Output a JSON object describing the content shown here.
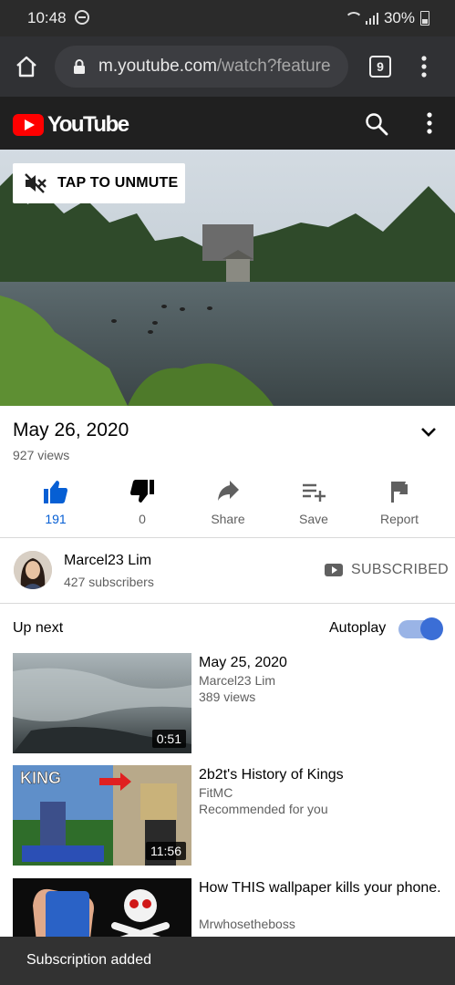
{
  "status_bar": {
    "time": "10:48",
    "battery": "30%"
  },
  "browser": {
    "url_host": "m.youtube.com",
    "url_path": "/watch?feature",
    "tab_count": "9"
  },
  "header": {
    "brand": "YouTube"
  },
  "video": {
    "unmute_label": "TAP TO UNMUTE"
  },
  "meta": {
    "title": "May 26, 2020",
    "views": "927 views"
  },
  "actions": {
    "like_count": "191",
    "dislike_count": "0",
    "share": "Share",
    "save": "Save",
    "report": "Report"
  },
  "channel": {
    "name": "Marcel23 Lim",
    "subscribers": "427 subscribers",
    "subscribed_label": "SUBSCRIBED"
  },
  "upnext": {
    "label": "Up next",
    "autoplay_label": "Autoplay",
    "autoplay_on": true
  },
  "videos": [
    {
      "title": "May 25, 2020",
      "channel": "Marcel23 Lim",
      "info": "389 views",
      "duration": "0:51"
    },
    {
      "title": "2b2t's History of Kings",
      "channel": "FitMC",
      "info": "Recommended for you",
      "duration": "11:56",
      "thumb_text": "KING"
    },
    {
      "title": "How THIS wallpaper kills your phone.",
      "channel": "Mrwhosetheboss",
      "info": ""
    }
  ],
  "snackbar": {
    "message": "Subscription added"
  },
  "colors": {
    "brand_red": "#ff0000",
    "link_blue": "#065fd4",
    "toggle_blue": "#3b6ed6"
  }
}
